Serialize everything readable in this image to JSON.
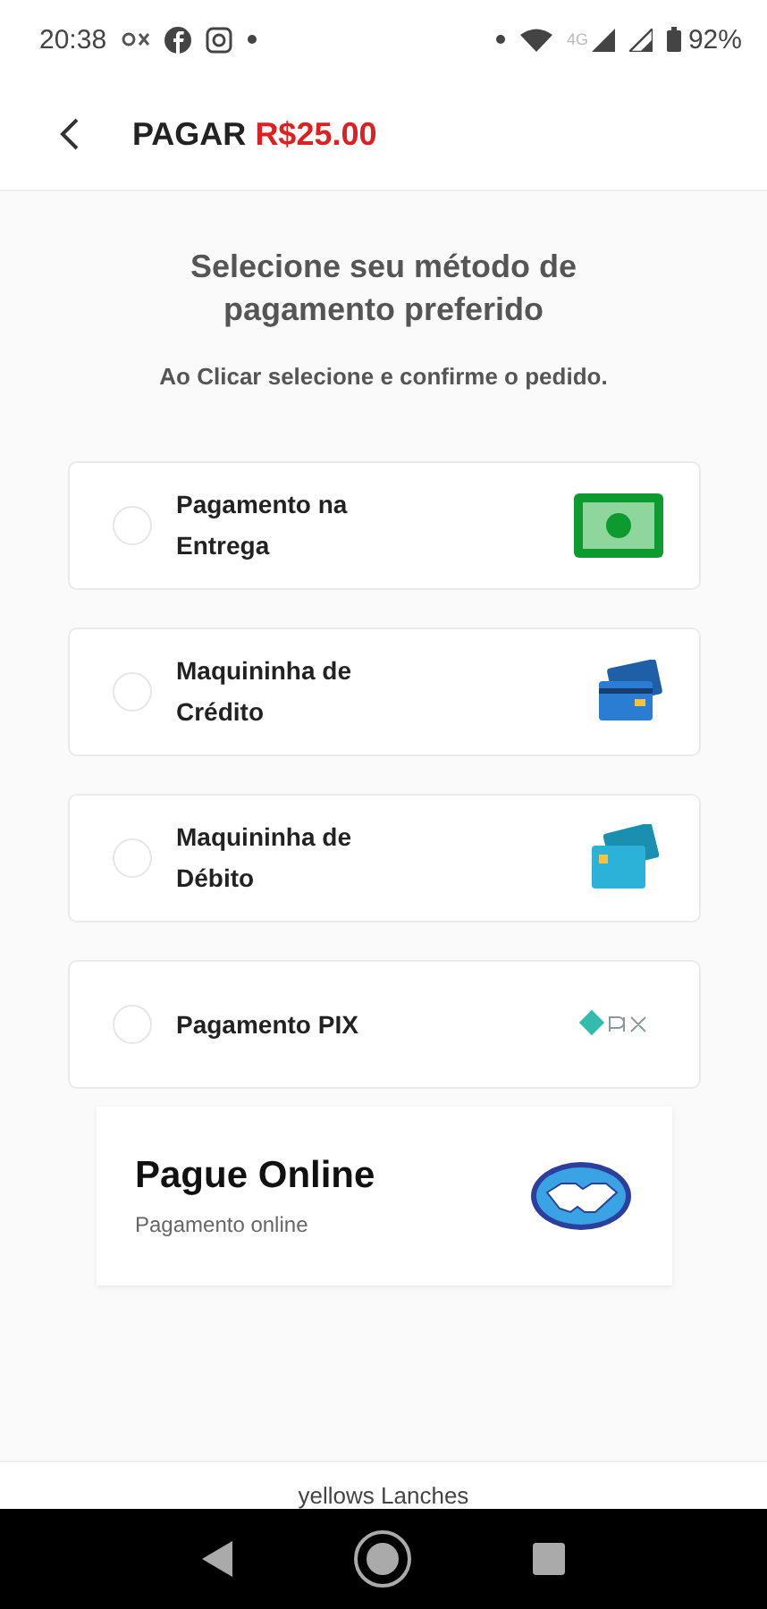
{
  "status_bar": {
    "time": "20:38",
    "network": "4G",
    "battery": "92%"
  },
  "header": {
    "title": "PAGAR",
    "amount": "R$25.00"
  },
  "heading": "Selecione seu método de pagamento preferido",
  "subtitle": "Ao Clicar selecione e confirme o pedido.",
  "methods": [
    {
      "label": "Pagamento na Entrega",
      "kind": "cash",
      "selected": false
    },
    {
      "label": "Maquininha de Crédito",
      "kind": "credit",
      "selected": false
    },
    {
      "label": "Maquininha de Débito",
      "kind": "debit",
      "selected": false
    },
    {
      "label": "Pagamento PIX",
      "kind": "pix",
      "selected": false
    }
  ],
  "online": {
    "title": "Pague Online",
    "subtitle": "Pagamento online"
  },
  "footer": "yellows Lanches"
}
